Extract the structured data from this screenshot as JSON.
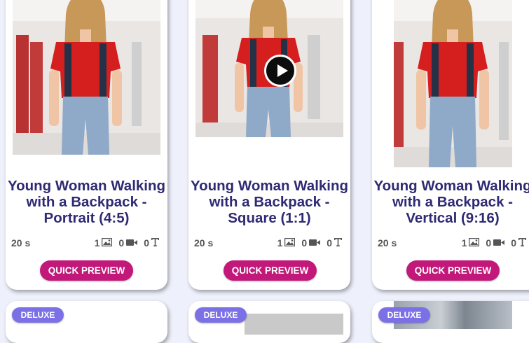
{
  "cards": [
    {
      "title_lines": [
        "Young Woman Walking",
        "with a Backpack -",
        "Portrait (4:5)"
      ],
      "duration": "20 s",
      "counts": {
        "images": "1",
        "videos": "0",
        "texts": "0"
      },
      "preview_label": "QUICK PREVIEW",
      "playing": false
    },
    {
      "title_lines": [
        "Young Woman Walking",
        "with a Backpack -",
        "Square (1:1)"
      ],
      "duration": "20 s",
      "counts": {
        "images": "1",
        "videos": "0",
        "texts": "0"
      },
      "preview_label": "QUICK PREVIEW",
      "playing": true
    },
    {
      "title_lines": [
        "Young Woman Walking",
        "with a Backpack -",
        "Vertical (9:16)"
      ],
      "duration": "20 s",
      "counts": {
        "images": "1",
        "videos": "0",
        "texts": "0"
      },
      "preview_label": "QUICK PREVIEW",
      "playing": false
    }
  ],
  "bottom_cards": [
    {
      "badge": "DELUXE"
    },
    {
      "badge": "DELUXE"
    },
    {
      "badge": "DELUXE"
    }
  ],
  "icons": {
    "image": "image-icon",
    "video": "video-camera-icon",
    "text": "text-icon",
    "play": "play-icon"
  },
  "colors": {
    "title": "#2e2a73",
    "button": "#c2187a",
    "badge": "#7b70e6",
    "page_background": "#eef0fb"
  }
}
